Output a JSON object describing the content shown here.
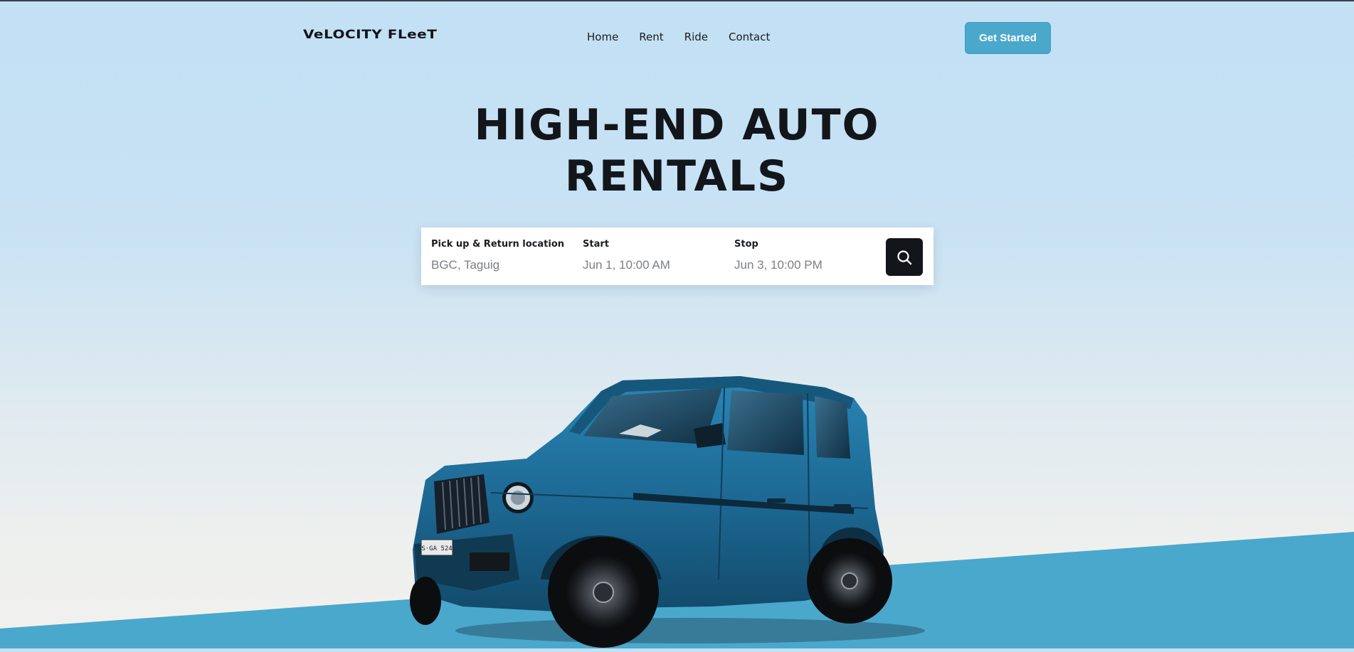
{
  "header": {
    "logo": "VeLOCITY FLeeT",
    "nav": [
      "Home",
      "Rent",
      "Ride",
      "Contact"
    ],
    "cta_label": "Get Started"
  },
  "hero": {
    "title_line1": "HIGH-END AUTO",
    "title_line2": "RENTALS"
  },
  "search": {
    "location": {
      "label": "Pick up & Return location",
      "value": "BGC, Taguig"
    },
    "start": {
      "label": "Start",
      "value": "Jun 1, 10:00 AM"
    },
    "stop": {
      "label": "Stop",
      "value": "Jun 3, 10:00 PM"
    },
    "button_icon": "search-icon"
  },
  "vehicle": {
    "plate": "S·GA 524"
  },
  "colors": {
    "accent": "#4aa8cc",
    "dark": "#12161b",
    "car_body": "#1e6f9a"
  }
}
